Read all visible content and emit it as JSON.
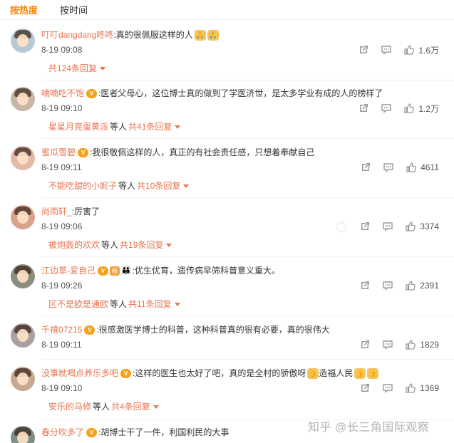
{
  "tabs": {
    "hot": "按热度",
    "time": "按时间"
  },
  "colors": {
    "accent": "#ff8200",
    "username": "#eb7350"
  },
  "comments": [
    {
      "username": "叮叮dangdang咚咚",
      "text": ":真的很佩服这样的人",
      "emojis": [
        "pray",
        "pray"
      ],
      "time": "8-19 09:08",
      "likes": "1.6万",
      "replies": {
        "lead": "",
        "mid": "",
        "count": "共124条回复"
      },
      "avatar_color": "#b8c9d6"
    },
    {
      "username": "喃喃吃不饱",
      "badge": "vip",
      "text": ":医者父母心，这位博士真的做到了学医济世，是太多学业有成的人的榜样了",
      "time": "8-19 09:10",
      "likes": "1.2万",
      "replies": {
        "lead": "星星月亮蛋黄派",
        "mid": "等人",
        "count": "共41条回复"
      },
      "avatar_color": "#c9b7a6"
    },
    {
      "username": "蜜瓜雪碧",
      "badge": "vip",
      "text": ":我很敬佩这样的人，真正的有社会责任感，只想着奉献自己",
      "time": "8-19 09:11",
      "likes": "4611",
      "replies": {
        "lead": "不能吃甜的小妮子",
        "mid": "等人",
        "count": "共10条回复"
      },
      "avatar_color": "#e3b9a8"
    },
    {
      "username": "尚雨轩_",
      "text": ":厉害了",
      "time": "8-19 09:06",
      "likes": "3374",
      "replies": {
        "lead": "被炮轰的欢欢",
        "mid": "等人",
        "count": "共19条回复"
      },
      "avatar_color": "#d9a28a"
    },
    {
      "username": "江边草-爱自己",
      "badge": "vip",
      "text": ":优生优育，遗传病早筛科普意义重大。",
      "time": "8-19 09:26",
      "likes": "2391",
      "replies": {
        "lead": "区不是欧是通欧",
        "mid": "等人",
        "count": "共11条回复"
      },
      "avatar_color": "#8a8f7d"
    },
    {
      "username": "千禧07215",
      "badge": "vip",
      "text": ":很感激医学博士的科普，这种科普真的很有必要，真的很伟大",
      "time": "8-19 09:11",
      "likes": "1829",
      "replies": {
        "lead": "",
        "mid": "",
        "count": ""
      },
      "avatar_color": "#a9a0a0"
    },
    {
      "username": "没事就喝点养乐多吧",
      "badge": "vip",
      "text": ":这样的医生也太好了吧，真的是全村的骄傲呀",
      "text2": "造福人民",
      "time": "8-19 09:10",
      "likes": "1369",
      "replies": {
        "lead": "安乐的马修",
        "mid": "等人",
        "count": "共4条回复"
      },
      "avatar_color": "#c6a98f"
    },
    {
      "username": "春分吹多了",
      "badge": "vip",
      "text": ":胡博士干了一件，利国利民的大事",
      "time": "",
      "likes": "",
      "replies": {
        "lead": "",
        "mid": "",
        "count": ""
      },
      "avatar_color": "#7f8f86"
    }
  ],
  "icons": {
    "share": "share-icon",
    "comment": "comment-icon",
    "like": "thumbs-up-icon"
  },
  "watermark": "知乎 @长三角国际观察"
}
